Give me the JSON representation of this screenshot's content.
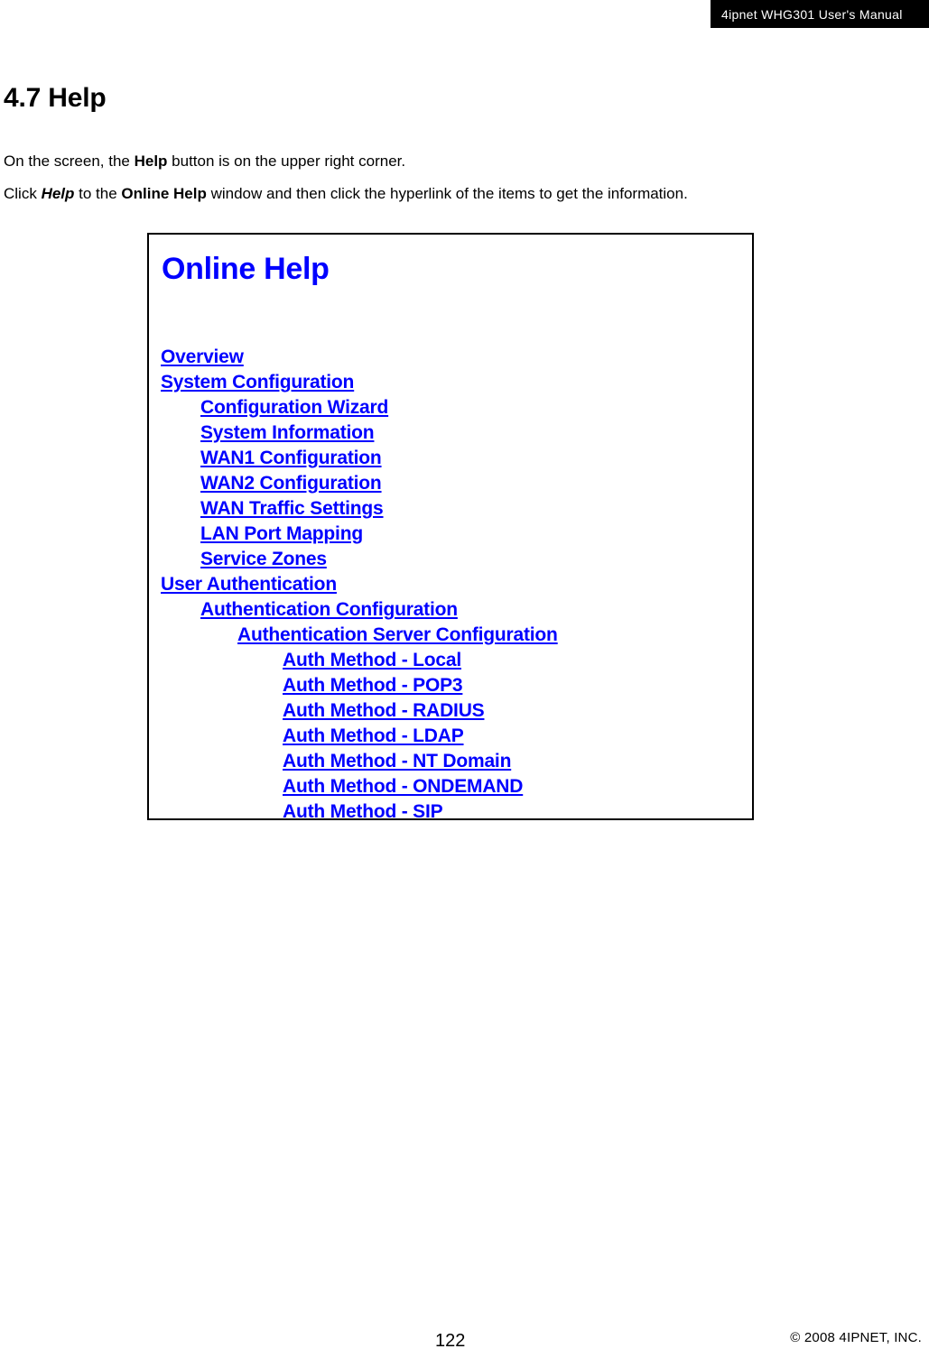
{
  "header": {
    "running_title": "4ipnet WHG301 User's Manual"
  },
  "section": {
    "title": "4.7 Help"
  },
  "body": {
    "paragraph_1": {
      "part_1": "On the screen, the ",
      "bold_1": "Help",
      "part_2": " button is on the upper right corner."
    },
    "paragraph_2": {
      "part_1": "Click ",
      "bold_italic_1": "Help",
      "part_2": " to the ",
      "bold_2": "Online Help",
      "part_3": " window and then click the hyperlink of the items to get the information."
    }
  },
  "screenshot": {
    "title": "Online Help",
    "link_color": "#0000ff",
    "links": [
      {
        "label": "Overview",
        "level": 1
      },
      {
        "label": "System Configuration",
        "level": 1
      },
      {
        "label": "Configuration Wizard",
        "level": 2
      },
      {
        "label": "System Information",
        "level": 2
      },
      {
        "label": "WAN1 Configuration",
        "level": 2
      },
      {
        "label": "WAN2 Configuration",
        "level": 2
      },
      {
        "label": "WAN Traffic Settings",
        "level": 2
      },
      {
        "label": "LAN Port Mapping",
        "level": 2
      },
      {
        "label": "Service Zones",
        "level": 2
      },
      {
        "label": "User Authentication",
        "level": 1
      },
      {
        "label": "Authentication Configuration",
        "level": 2
      },
      {
        "label": "Authentication Server Configuration",
        "level": 3
      },
      {
        "label": "Auth Method - Local",
        "level": 4
      },
      {
        "label": "Auth Method - POP3",
        "level": 4
      },
      {
        "label": "Auth Method - RADIUS",
        "level": 4
      },
      {
        "label": "Auth Method - LDAP",
        "level": 4
      },
      {
        "label": "Auth Method - NT Domain",
        "level": 4
      },
      {
        "label": "Auth Method - ONDEMAND",
        "level": 4
      },
      {
        "label": "Auth Method - SIP",
        "level": 4
      }
    ]
  },
  "footer": {
    "page_number": "122",
    "copyright": "© 2008 4IPNET, INC."
  }
}
